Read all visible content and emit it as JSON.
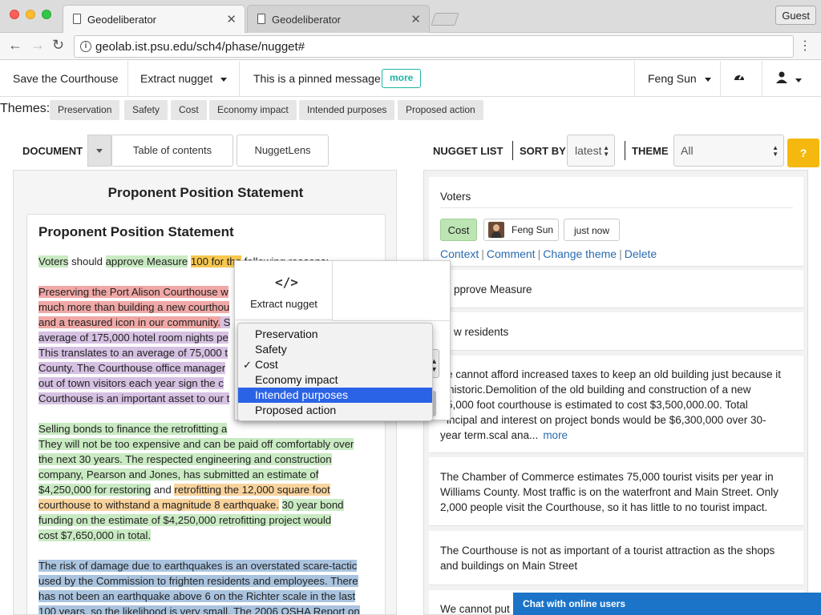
{
  "browser": {
    "tabs": [
      {
        "title": "Geodeliberator"
      },
      {
        "title": "Geodeliberator"
      }
    ],
    "guest_label": "Guest",
    "url": "geolab.ist.psu.edu/sch4/phase/nugget#"
  },
  "navbar": {
    "save_label": "Save the Courthouse",
    "extract_label": "Extract nugget",
    "pinned_message": "This is a pinned message",
    "more_label": "more",
    "user_name": "Feng Sun"
  },
  "themes": {
    "label": "Themes:",
    "chips": [
      "Preservation",
      "Safety",
      "Cost",
      "Economy impact",
      "Intended purposes",
      "Proposed action"
    ]
  },
  "document": {
    "header_label": "DOCUMENT",
    "toc_label": "Table of contents",
    "nuggetlens_label": "NuggetLens",
    "title": "Proponent Position Statement",
    "card_title": "Proponent Position Statement",
    "p1": {
      "a": "Voters",
      "b": " should ",
      "c": "approve Measure",
      "d": " ",
      "e": "100 for the",
      "f": " following reasons:"
    },
    "p2": {
      "red1": "Preserving the Port Alison Courthouse w",
      "red2": "much more than building a new courthou",
      "red3": "and a treasured icon in our community.",
      "red3b": " S",
      "purple1": "average of 175,000 hotel room nights pe",
      "purple2": "This translates to an average of 75,000 t",
      "purple3": "County. The Courthouse office manager",
      "purple4": "out of town visitors each year sign the c",
      "purple5": "Courthouse is an important asset to our t"
    },
    "p3": {
      "l1": "Selling bonds to finance the retrofitting a",
      "l2": "They will not be too expensive and can be paid off comfortably over",
      "l3": "the next 30 years. The respected engineering and construction",
      "l4": "company, Pearson and Jones, has submitted an estimate of",
      "l5a": "$4,250,000 for restoring",
      "l5b": " and ",
      "l5c": "retrofitting the 12,000 square foot",
      "l6a": "courthouse to withstand a magnitude 8 earthquake.",
      "l6b": " ",
      "l6c": "30 year bond",
      "l7": "funding on the estimate of $4,250,000 retrofitting project would",
      "l8": "cost $7,650,000 in total."
    },
    "p4": {
      "l1": "The risk of damage due to earthquakes is an overstated scare-tactic",
      "l2": "used by the Commission to frighten residents and employees. There",
      "l3": "has not been an earthquake above 6 on the Richter scale in the last",
      "l4": "100 years, so the likelihood is very small. The 2006 OSHA Report on"
    }
  },
  "popup": {
    "tool_label": "Extract nugget",
    "options": [
      "Preservation",
      "Safety",
      "Cost",
      "Economy impact",
      "Intended purposes",
      "Proposed action"
    ],
    "checked": "Cost",
    "highlighted": "Intended purposes"
  },
  "nuggets": {
    "list_label": "NUGGET LIST",
    "sort_label": "SORT BY",
    "sort_value": "latest",
    "theme_label": "THEME",
    "theme_value": "All",
    "help_label": "?",
    "first": {
      "text": "Voters",
      "theme": "Cost",
      "user": "Feng Sun",
      "time": "just now",
      "links": [
        "Context",
        "Comment",
        "Change theme",
        "Delete"
      ]
    },
    "items": [
      {
        "text": "pprove Measure"
      },
      {
        "text": "w residents"
      },
      {
        "l1": "e cannot afford increased taxes to keep an old building just because it",
        "l2": "historic.Demolition of the old building and construction of a new",
        "l3": "5,000 foot courthouse is estimated to cost $3,500,000.00. Total",
        "l4": "incipal and interest on project bonds would be $6,300,000 over 30-",
        "l5": "year term.scal ana...",
        "more": "more"
      },
      {
        "l1": "The Chamber of Commerce estimates 75,000 tourist visits per year in",
        "l2": "Williams County. Most traffic is on the waterfront and Main Street. Only",
        "l3": "2,000 people visit the Courthouse, so it has little to no tourist impact."
      },
      {
        "l1": "The Courthouse is not as important of a tourist attraction as the shops",
        "l2": "and buildings on Main Street"
      },
      {
        "l1": "We cannot put"
      }
    ],
    "chat_label": "Chat with online users"
  },
  "colors": {
    "accent_teal": "#1eb5a6",
    "help_yellow": "#f5b80f",
    "link_blue": "#2a6bb0",
    "chat_blue": "#1b74c8",
    "select_blue": "#2b63e6"
  }
}
